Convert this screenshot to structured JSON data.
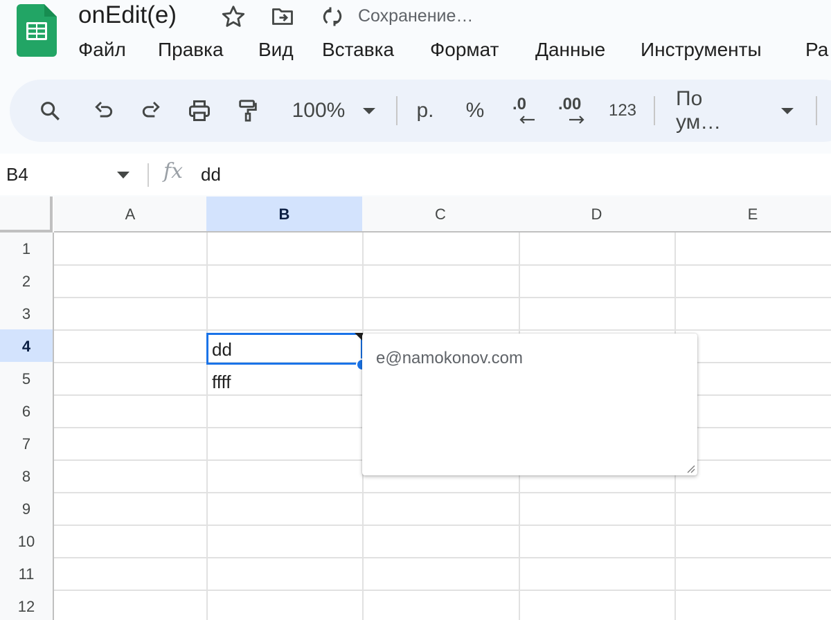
{
  "header": {
    "doc_title": "onEdit(e)",
    "saving_status": "Сохранение…",
    "icons": {
      "app": "sheets-logo-icon",
      "star": "star-icon",
      "move": "move-to-folder-icon",
      "sync": "sync-icon"
    }
  },
  "menu": [
    "Файл",
    "Правка",
    "Вид",
    "Вставка",
    "Формат",
    "Данные",
    "Инструменты",
    "Ра"
  ],
  "toolbar": {
    "zoom": "100%",
    "currency": "р.",
    "percent": "%",
    "decrease_decimal": ".0",
    "increase_decimal": ".00",
    "more_formats": "123",
    "font": "По ум…",
    "icons": [
      "search-icon",
      "undo-icon",
      "redo-icon",
      "print-icon",
      "paint-format-icon"
    ]
  },
  "formula_bar": {
    "name_box": "B4",
    "fx_label": "fx",
    "value": "dd"
  },
  "grid": {
    "columns": [
      "A",
      "B",
      "C",
      "D",
      "E"
    ],
    "rows": [
      "1",
      "2",
      "3",
      "4",
      "5",
      "6",
      "7",
      "8",
      "9",
      "10",
      "11",
      "12"
    ],
    "selected_column": "B",
    "selected_row": "4",
    "cells": {
      "B4": "dd",
      "B5": "ffff"
    }
  },
  "note": {
    "text": "e@namokonov.com"
  },
  "colors": {
    "accent": "#1a73e8",
    "selected_header": "#d3e3fd",
    "sheets_green": "#22a565"
  }
}
